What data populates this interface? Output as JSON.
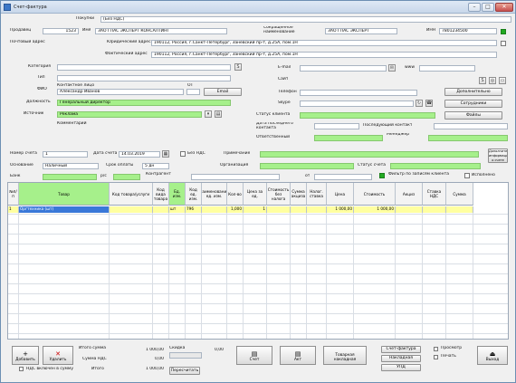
{
  "window": {
    "title": "Счет-фактура"
  },
  "header": {
    "purchases_label": "Покупки",
    "purchases_value": "(Без НДС)",
    "seller_label": "Продавец",
    "number_value": "1523",
    "seller_name_label": "Имя",
    "seller_name_value": "ЗАО ГЛАС ЭКСПЕРТ КОНСАЛТИНГ",
    "seller_short_label": "Сокращенное наименование",
    "seller_short_value": "ЗАО ГЛАС ЭКСПЕРТ",
    "inn_label": "ИНН",
    "inn_value": "7801234500",
    "postal_address_label": "Почтовый адрес",
    "postal_address_value": "190112, Россия, г.Санкт-Петербург, Заневский пр-т, д.25А, пом.1Н",
    "legal_address_label": "Юридический адрес",
    "legal_address_value": "190112, Россия, г.Санкт-Петербург, Заневский пр-т, д.25А, пом.1Н",
    "actual_address_label": "Фактический адрес",
    "actual_address_value": "190112, Россия, г.Санкт-Петербург, Заневский пр-т, д.25А, пом.1Н"
  },
  "contact": {
    "category_label": "Категория",
    "type_label": "Тип",
    "contact_person_label": "ФИО",
    "contact_person_value": "Контактное лицо",
    "contact_name_value": "Александр Иванов",
    "on_label": "ОТ",
    "post_label": "Должность",
    "post_value": "Генеральный директор",
    "source_label": "Источник",
    "source_value": "Реклама",
    "comment_label": "Комментарий",
    "email_btn": "Email",
    "email_label": "E-mail",
    "email_value": "",
    "site_label": "Сайт",
    "phone_label": "Телефон",
    "skype_label": "Skype",
    "counterparty_status_label": "Статус клиента",
    "date_last_label": "Дата последнего контакта",
    "date_next_label": "Последующий контакт",
    "responsible_label": "Ответственный",
    "manager_label": "Менеджер",
    "btn_more": "Дополнительно",
    "btn_employees": "Сотрудники",
    "btn_files": "Файлы"
  },
  "invoice": {
    "invoice_num_label": "Номер счета",
    "invoice_num_value": "1",
    "invoice_date_label": "Дата счета",
    "invoice_date_value": "14.03.2019",
    "no_vat_label": "Без НДС",
    "note_label": "Примечание",
    "payment_label": "Основание",
    "payment_value": "Наличный",
    "org_label": "Организация",
    "status_label": "Статус счета",
    "period_label": "Срок оплаты",
    "period_value": "5 дн",
    "extra_btn": "Дополнительная информация о счете",
    "bank_label": "Банк",
    "rs_label": "р/с",
    "contract_label": "Контрагент",
    "ot_label": "от",
    "filter_label": "Фильтр по записям клиента",
    "exec_label": "Исполнено"
  },
  "grid": {
    "columns": [
      {
        "label": "№п/п"
      },
      {
        "label": "Товар"
      },
      {
        "label": "Код товара/услуги"
      },
      {
        "label": "Код вида товара"
      },
      {
        "label": "Ед. изм."
      },
      {
        "label": "Код ед. изм."
      },
      {
        "label": "Наименование ед. изм."
      },
      {
        "label": "Кол-во"
      },
      {
        "label": "Цена за ед."
      },
      {
        "label": "Стоимость без налога"
      },
      {
        "label": "Сумма акциза"
      },
      {
        "label": "Налог. ставка"
      },
      {
        "label": "Цена"
      },
      {
        "label": "Стоимость"
      },
      {
        "label": "Акциз"
      },
      {
        "label": "Ставка НДС"
      },
      {
        "label": "Сумма"
      }
    ],
    "rows": [
      [
        "1",
        "Оргтехника (шт)",
        "",
        "",
        "шт",
        "796",
        "",
        "1,000",
        "1",
        "",
        "",
        "",
        "1 000,00",
        "1 000,00",
        "",
        "",
        ""
      ]
    ]
  },
  "footer": {
    "add_label": "Добавить",
    "delete_label": "Удалить",
    "vat_included_label": "НДС включен в сумму",
    "total_sum_label": "Итого сумма",
    "total_sum_value": "1 000,00",
    "vat_sum_label": "Сумма НДС",
    "vat_sum_value": "0,00",
    "total_label": "Итого",
    "total_value": "1 000,00",
    "discount_label": "Скидка",
    "discount_value": "0,00",
    "recalc_label": "Пересчитать",
    "print_label": "Счет",
    "act_label": "Акт",
    "nakl_label": "Накладная",
    "acts_label": "Документы",
    "sf_label": "Счет-фактура",
    "torg_label": "Товарная накладная",
    "upd_label": "УПД",
    "preview_label": "Просмотр",
    "print2_label": "Печать",
    "exit_label": "Выход"
  }
}
